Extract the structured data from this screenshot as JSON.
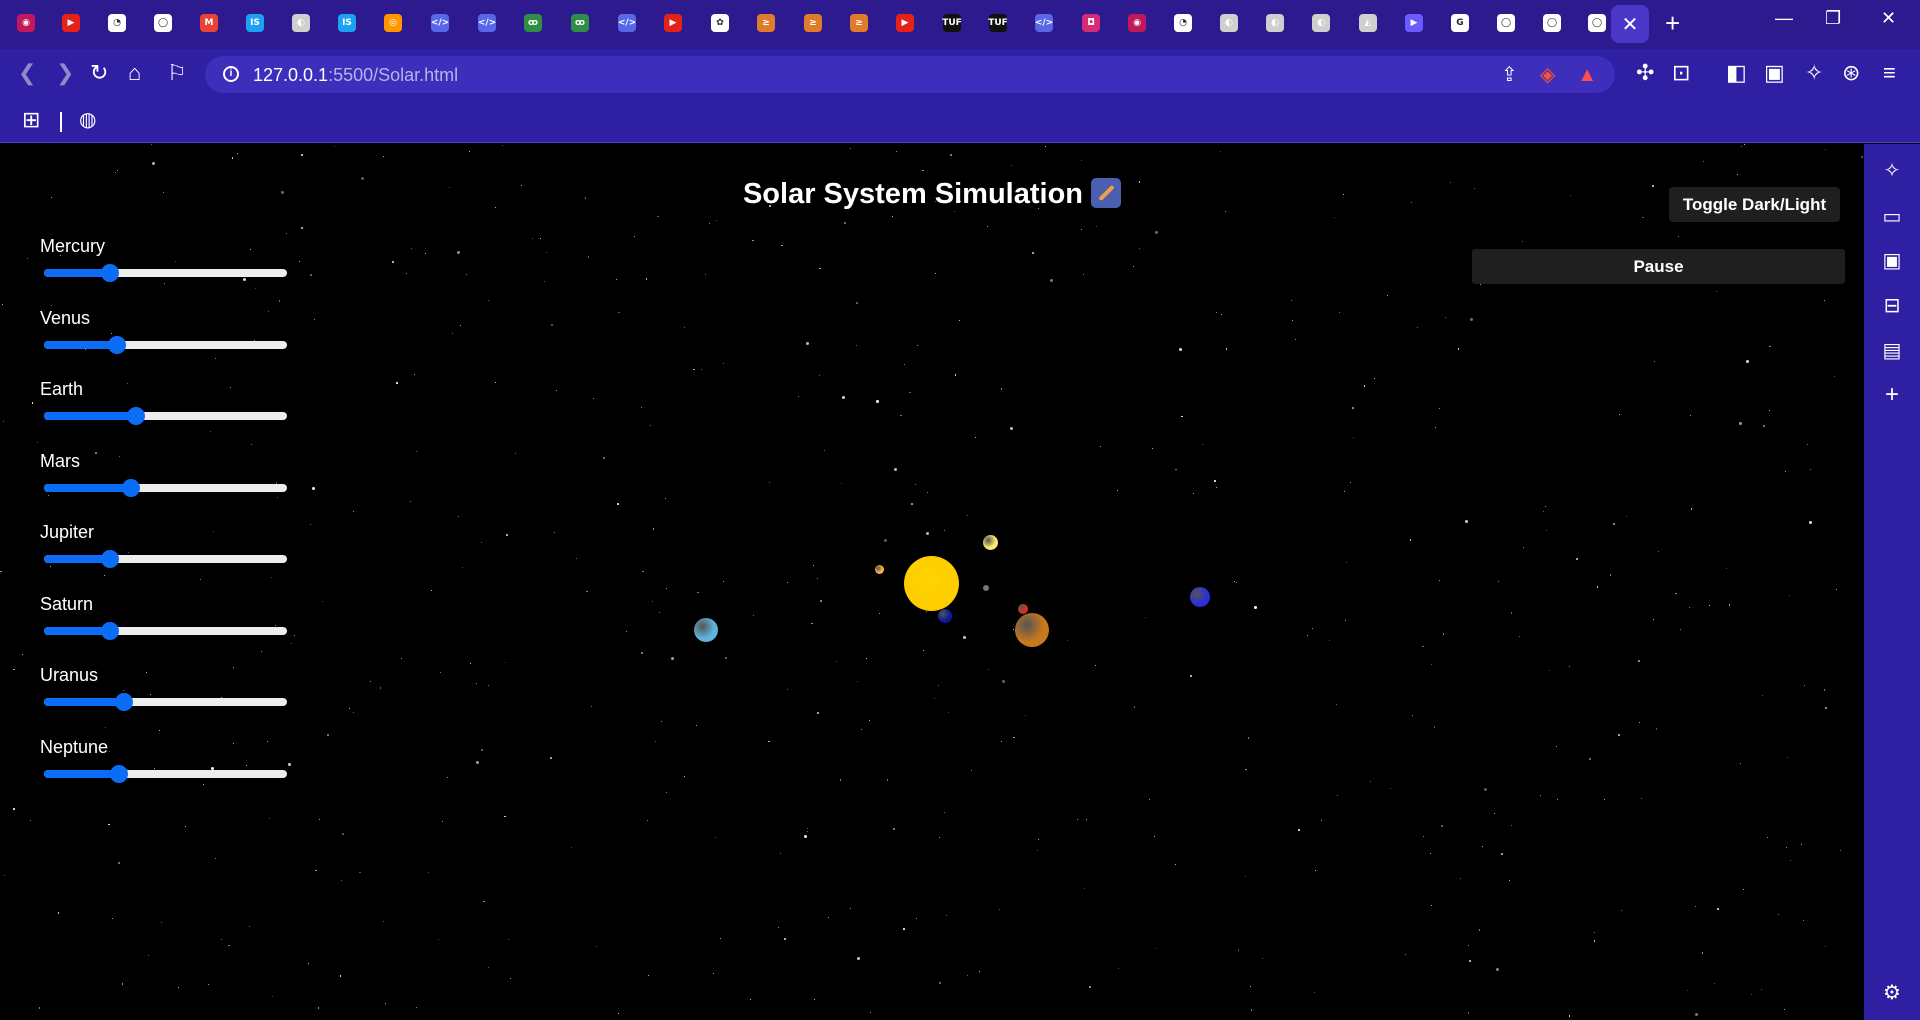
{
  "browser": {
    "tabs": [
      {
        "icon": "radar-icon",
        "color": "#c2185b",
        "glyph": "◉"
      },
      {
        "icon": "youtube-icon",
        "color": "#e62117",
        "glyph": "▶"
      },
      {
        "icon": "leetcode-icon",
        "color": "#ffffff",
        "glyph": "◔"
      },
      {
        "icon": "github-icon",
        "color": "#ffffff",
        "glyph": "◯"
      },
      {
        "icon": "gmail-icon",
        "color": "#ea4335",
        "glyph": "M"
      },
      {
        "icon": "is-icon",
        "color": "#1da1f2",
        "glyph": "IS"
      },
      {
        "icon": "globe-icon",
        "color": "#cfcfcf",
        "glyph": "◐"
      },
      {
        "icon": "is-icon",
        "color": "#1da1f2",
        "glyph": "IS"
      },
      {
        "icon": "colab-icon",
        "color": "#ff9800",
        "glyph": "◎"
      },
      {
        "icon": "code-icon",
        "color": "#5866e8",
        "glyph": "</>"
      },
      {
        "icon": "code-icon",
        "color": "#5866e8",
        "glyph": "</>"
      },
      {
        "icon": "gfg-icon",
        "color": "#2f8d46",
        "glyph": "ꝏ"
      },
      {
        "icon": "gfg-icon",
        "color": "#2f8d46",
        "glyph": "ꝏ"
      },
      {
        "icon": "code-icon",
        "color": "#5866e8",
        "glyph": "</>"
      },
      {
        "icon": "youtube-icon",
        "color": "#e62117",
        "glyph": "▶"
      },
      {
        "icon": "openai-icon",
        "color": "#ffffff",
        "glyph": "✿"
      },
      {
        "icon": "codechef-icon",
        "color": "#e07b2c",
        "glyph": "≥"
      },
      {
        "icon": "codechef-icon",
        "color": "#e07b2c",
        "glyph": "≥"
      },
      {
        "icon": "codechef-icon",
        "color": "#e07b2c",
        "glyph": "≥"
      },
      {
        "icon": "youtube-icon",
        "color": "#e62117",
        "glyph": "▶"
      },
      {
        "icon": "tuf-icon",
        "color": "#111111",
        "glyph": "TUF"
      },
      {
        "icon": "tuf-icon",
        "color": "#111111",
        "glyph": "TUF"
      },
      {
        "icon": "code-icon",
        "color": "#5866e8",
        "glyph": "</>"
      },
      {
        "icon": "instagram-icon",
        "color": "#d62976",
        "glyph": "◘"
      },
      {
        "icon": "pin-icon",
        "color": "#c2185b",
        "glyph": "◉"
      },
      {
        "icon": "leetcode-icon",
        "color": "#ffffff",
        "glyph": "◔"
      },
      {
        "icon": "globe-icon",
        "color": "#cfcfcf",
        "glyph": "◐"
      },
      {
        "icon": "globe-icon",
        "color": "#cfcfcf",
        "glyph": "◐"
      },
      {
        "icon": "globe-icon",
        "color": "#cfcfcf",
        "glyph": "◐"
      },
      {
        "icon": "triangle-icon",
        "color": "#cfcfcf",
        "glyph": "◭"
      },
      {
        "icon": "play-icon",
        "color": "#6a5cff",
        "glyph": "▶"
      },
      {
        "icon": "google-icon",
        "color": "#ffffff",
        "glyph": "G"
      },
      {
        "icon": "github-icon",
        "color": "#ffffff",
        "glyph": "◯"
      },
      {
        "icon": "github-icon",
        "color": "#ffffff",
        "glyph": "◯"
      },
      {
        "icon": "github-icon",
        "color": "#ffffff",
        "glyph": "◯"
      }
    ],
    "url_host": "127.0.0.1",
    "url_path": ":5500/Solar.html"
  },
  "page": {
    "title": "Solar System Simulation",
    "toggle_label": "Toggle Dark/Light",
    "pause_label": "Pause"
  },
  "planets": [
    {
      "name": "Mercury",
      "speed": 0.27,
      "color": "#ffb347",
      "size": 9
    },
    {
      "name": "Venus",
      "speed": 0.3,
      "color": "#ffea70",
      "size": 15
    },
    {
      "name": "Earth",
      "speed": 0.38,
      "color": "#0a1a9a",
      "size": 14
    },
    {
      "name": "Mars",
      "speed": 0.36,
      "color": "#d8321f",
      "size": 10
    },
    {
      "name": "Jupiter",
      "speed": 0.27,
      "color": "#c7791b",
      "size": 34
    },
    {
      "name": "Saturn",
      "speed": 0.27,
      "color": "#2a2fd8",
      "size": 20
    },
    {
      "name": "Uranus",
      "speed": 0.33,
      "color": "#5fb3dc",
      "size": 24
    },
    {
      "name": "Neptune",
      "speed": 0.31,
      "color": "#4d6fb0",
      "size": 10
    }
  ],
  "sun_color": "#ffc800"
}
